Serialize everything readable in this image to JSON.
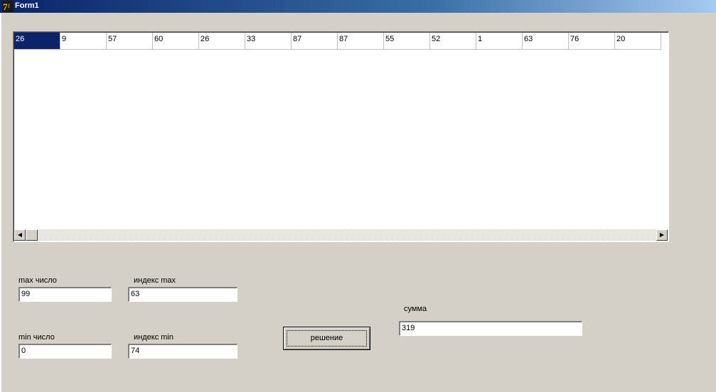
{
  "window": {
    "title": "Form1"
  },
  "grid": {
    "cells": [
      "26",
      "9",
      "57",
      "60",
      "26",
      "33",
      "87",
      "87",
      "55",
      "52",
      "1",
      "63",
      "76",
      "20"
    ],
    "selected_index": 0
  },
  "fields": {
    "max_label": "max число",
    "max_value": "99",
    "max_index_label": "индекс max",
    "max_index_value": "63",
    "min_label": "min число",
    "min_value": "0",
    "min_index_label": "индекс min",
    "min_index_value": "74",
    "sum_label": "сумма",
    "sum_value": "319"
  },
  "actions": {
    "solve_label": "решение"
  },
  "icons": {
    "app": "delphi-app-icon",
    "scroll_left": "scroll-left-arrow-icon",
    "scroll_right": "scroll-right-arrow-icon"
  },
  "colors": {
    "selection": "#0a246a",
    "face": "#d4d0c8"
  }
}
